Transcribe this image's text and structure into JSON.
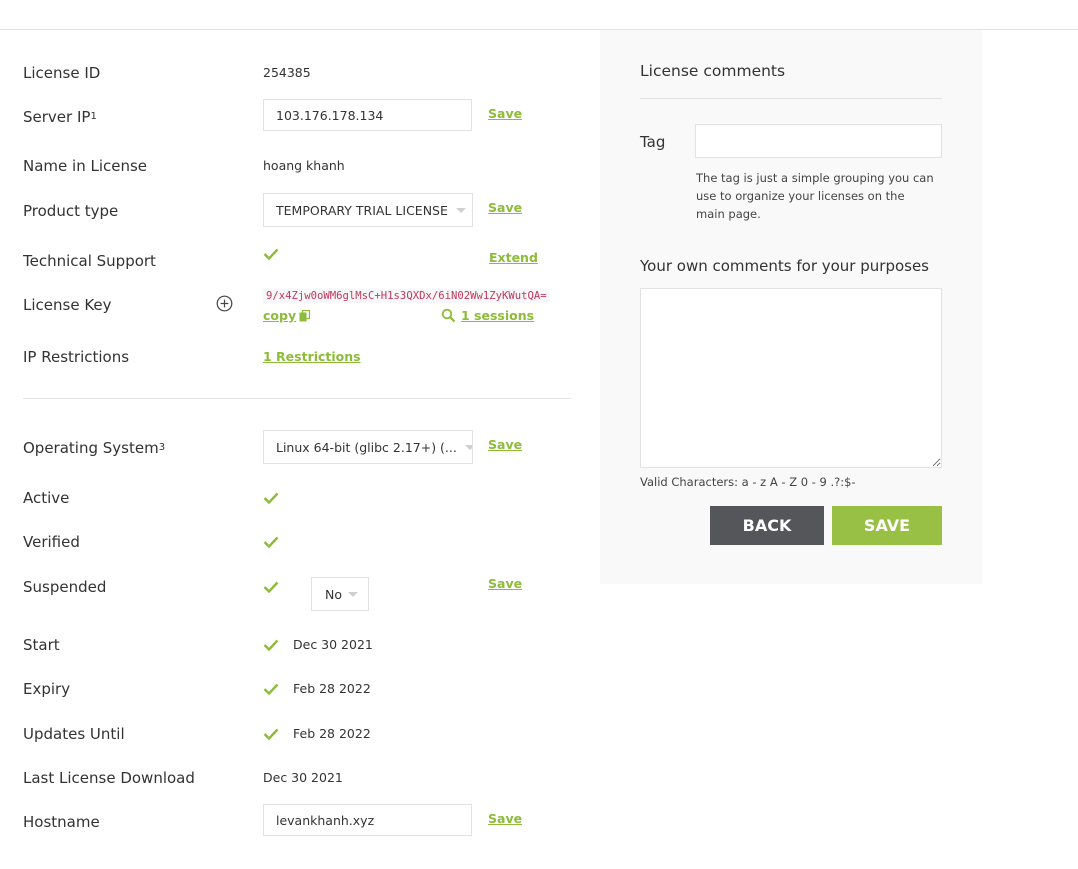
{
  "colors": {
    "accent": "#8dbb3a",
    "check": "#8dbb3a",
    "back_button": "#54565a",
    "save_button": "#98c045",
    "key_text": "#c0395a"
  },
  "license": {
    "license_id": {
      "label": "License ID",
      "value": "254385"
    },
    "server_ip": {
      "label": "Server IP",
      "sup": "1",
      "value": "103.176.178.134",
      "save": "Save"
    },
    "name_in_license": {
      "label": "Name in License",
      "value": "hoang khanh"
    },
    "product_type": {
      "label": "Product type",
      "value": "TEMPORARY TRIAL LICENSE",
      "save": "Save"
    },
    "technical_support": {
      "label": "Technical Support",
      "status_icon": "check-icon",
      "action": "Extend"
    },
    "license_key": {
      "label": "License Key",
      "expand_icon": "plus-circle-icon",
      "value": "9/x4Zjw0oWM6glMsC+H1s3QXDx/6iN02Ww1ZyKWutQA=",
      "copy": "copy",
      "sessions": "1 sessions"
    },
    "ip_restrictions": {
      "label": "IP Restrictions",
      "link": "1 Restrictions"
    }
  },
  "status": {
    "operating_system": {
      "label": "Operating System",
      "sup": "3",
      "value": "Linux 64-bit (glibc 2.17+) (...",
      "save": "Save"
    },
    "active": {
      "label": "Active",
      "status_icon": "check-icon"
    },
    "verified": {
      "label": "Verified",
      "status_icon": "check-icon"
    },
    "suspended": {
      "label": "Suspended",
      "status_icon": "check-icon",
      "value": "No",
      "save": "Save"
    },
    "start": {
      "label": "Start",
      "status_icon": "check-icon",
      "value": "Dec 30 2021"
    },
    "expiry": {
      "label": "Expiry",
      "status_icon": "check-icon",
      "value": "Feb 28 2022"
    },
    "updates_until": {
      "label": "Updates Until",
      "status_icon": "check-icon",
      "value": "Feb 28 2022"
    },
    "last_license_download": {
      "label": "Last License Download",
      "value": "Dec 30 2021"
    },
    "hostname": {
      "label": "Hostname",
      "value": "levankhanh.xyz",
      "save": "Save"
    }
  },
  "comments_panel": {
    "title": "License comments",
    "tag_label": "Tag",
    "tag_value": "",
    "tag_help": "The tag is just a simple grouping you can use to organize your licenses on the main page.",
    "comments_title": "Your own comments for your purposes",
    "comments_value": "",
    "valid_characters": "Valid Characters: a - z A - Z 0 - 9 .?:$-",
    "back_label": "BACK",
    "save_label": "SAVE"
  }
}
